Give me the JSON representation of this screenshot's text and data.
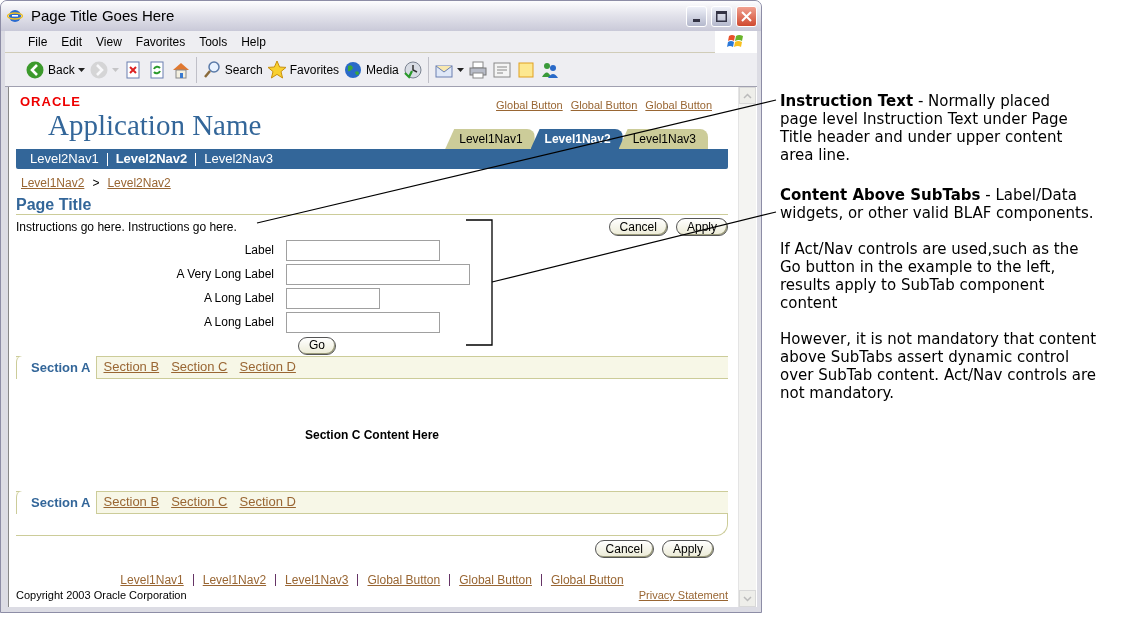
{
  "window": {
    "title": "Page Title Goes Here"
  },
  "menu_bar": [
    "File",
    "Edit",
    "View",
    "Favorites",
    "Tools",
    "Help"
  ],
  "toolbar": [
    [
      {
        "kind": "back",
        "label": "Back",
        "caret": true,
        "disabled": false
      },
      {
        "kind": "forward",
        "caret": true,
        "disabled": true
      },
      {
        "kind": "stop",
        "disabled": false
      },
      {
        "kind": "refresh",
        "disabled": false
      },
      {
        "kind": "home",
        "disabled": false
      }
    ],
    [
      {
        "kind": "search",
        "label": "Search",
        "disabled": false
      },
      {
        "kind": "favorites",
        "label": "Favorites",
        "disabled": false
      },
      {
        "kind": "media",
        "label": "Media",
        "disabled": false
      },
      {
        "kind": "history",
        "disabled": false
      }
    ],
    [
      {
        "kind": "mail",
        "caret": true,
        "disabled": false
      },
      {
        "kind": "print",
        "disabled": false
      },
      {
        "kind": "edit",
        "disabled": false
      },
      {
        "kind": "note",
        "disabled": false
      },
      {
        "kind": "messenger",
        "disabled": false
      }
    ]
  ],
  "page": {
    "logo": "ORACLE",
    "app_name": "Application Name",
    "global_buttons": [
      "Global Button",
      "Global Button",
      "Global Button"
    ],
    "level1_tabs": [
      {
        "label": "Level1Nav1",
        "selected": false
      },
      {
        "label": "Level1Nav2",
        "selected": true
      },
      {
        "label": "Level1Nav3",
        "selected": false
      }
    ],
    "level2_nav": [
      {
        "label": "Level2Nav1",
        "selected": false
      },
      {
        "label": "Level2Nav2",
        "selected": true
      },
      {
        "label": "Level2Nav3",
        "selected": false
      }
    ],
    "breadcrumbs": [
      "Level1Nav2",
      "Level2Nav2"
    ],
    "breadcrumb_separator": ">",
    "page_title": "Page Title",
    "instructions": "Instructions go here. Instructions go here.",
    "top_buttons": [
      "Cancel",
      "Apply"
    ],
    "fields": [
      {
        "label": "Label"
      },
      {
        "label": "A Very Long Label"
      },
      {
        "label": "A Long Label"
      },
      {
        "label": "A Long Label"
      }
    ],
    "go_button": "Go",
    "subtabs_top": [
      {
        "label": "Section A",
        "selected": true
      },
      {
        "label": "Section B",
        "selected": false
      },
      {
        "label": "Section C",
        "selected": false
      },
      {
        "label": "Section D",
        "selected": false
      }
    ],
    "section_content": "Section C Content Here",
    "subtabs_bottom": [
      {
        "label": "Section A",
        "selected": true
      },
      {
        "label": "Section B",
        "selected": false
      },
      {
        "label": "Section C",
        "selected": false
      },
      {
        "label": "Section D",
        "selected": false
      }
    ],
    "bottom_buttons": [
      "Cancel",
      "Apply"
    ],
    "footer_links": [
      "Level1Nav1",
      "Level1Nav2",
      "Level1Nav3",
      "Global Button",
      "Global Button",
      "Global Button"
    ],
    "copyright": "Copyright 2003 Oracle Corporation",
    "privacy": "Privacy Statement"
  },
  "annotations": [
    {
      "paragraphs": [
        "**Instruction Text** - Normally placed page level Instruction Text under Page Title header and under upper content area line."
      ]
    },
    {
      "paragraphs": [
        "**Content Above SubTabs** - Label/Data widgets, or other valid BLAF components.",
        "If Act/Nav controls are used,such as the Go button in the example to the left, results apply to SubTab component content",
        "However, it is not mandatory that content above SubTabs assert dynamic control over SubTab content. Act/Nav controls are not mandatory."
      ]
    }
  ]
}
